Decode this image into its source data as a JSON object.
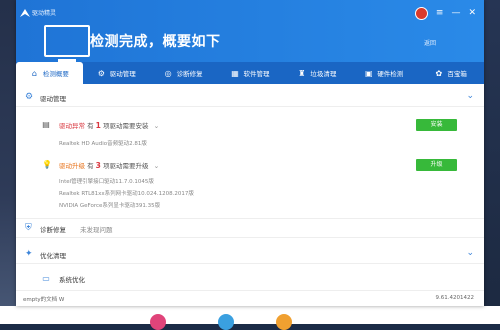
{
  "window": {
    "app_name": "驱动精灵",
    "headline": "检测完成，概要如下",
    "back_label": "返回",
    "controls": [
      "≡",
      "—",
      "✕"
    ]
  },
  "tabs": [
    {
      "label": "检测概要",
      "icon": "home-icon",
      "active": true
    },
    {
      "label": "驱动管理",
      "icon": "gear-icon",
      "active": false
    },
    {
      "label": "诊断修复",
      "icon": "compass-icon",
      "active": false
    },
    {
      "label": "软件管理",
      "icon": "appstore-icon",
      "active": false
    },
    {
      "label": "垃圾清理",
      "icon": "broom-icon",
      "active": false
    },
    {
      "label": "硬件检测",
      "icon": "chip-icon",
      "active": false
    },
    {
      "label": "百宝箱",
      "icon": "toolbox-icon",
      "active": false
    }
  ],
  "sections": {
    "driver_mgmt": {
      "title": "驱动管理"
    },
    "diag": {
      "title": "诊断修复",
      "status": "未发现问题"
    },
    "optimize": {
      "title": "优化清理"
    }
  },
  "driver_abnormal": {
    "status": "驱动异常",
    "prefix": "有",
    "count": "1",
    "suffix": "项驱动需要安装",
    "detail": "Realtek HD Audio音频驱动2.81版",
    "button": "安装"
  },
  "driver_upgrade": {
    "status": "驱动升级",
    "prefix": "有",
    "count": "3",
    "suffix": "项驱动需要升级",
    "details": [
      "Intel管理引擎接口驱动11.7.0.1045版",
      "Realtek RTL81xx系列网卡驱动10.024.1208.2017版",
      "NVIDIA GeForce系列显卡驱动391.35版"
    ],
    "button": "升级"
  },
  "system_optimize": {
    "label": "系统优化"
  },
  "footer": {
    "left": "empty的文档  W",
    "right": "9.61.4201422"
  },
  "colors": {
    "titlebar": "#1f74d6",
    "tabbar": "#1a66c4",
    "button": "#37b93a",
    "warning": "#d9363e",
    "upgrade": "#e8731b"
  }
}
